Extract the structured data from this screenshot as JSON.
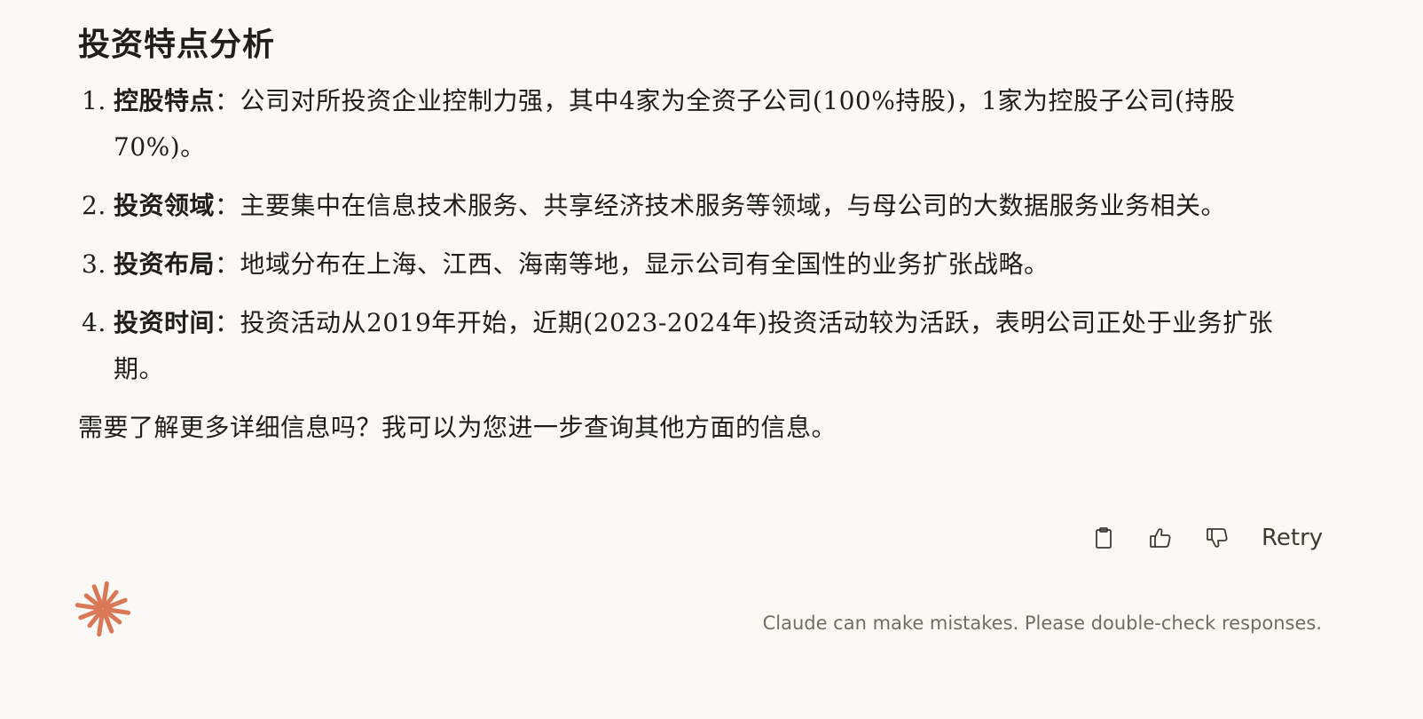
{
  "response": {
    "heading": "投资特点分析",
    "points": [
      {
        "num": "1.",
        "title": "控股特点",
        "sep": "：",
        "text": "公司对所投资企业控制力强，其中4家为全资子公司(100%持股)，1家为控股子公司(持股70%)。"
      },
      {
        "num": "2.",
        "title": "投资领域",
        "sep": "：",
        "text": "主要集中在信息技术服务、共享经济技术服务等领域，与母公司的大数据服务业务相关。"
      },
      {
        "num": "3.",
        "title": "投资布局",
        "sep": "：",
        "text": "地域分布在上海、江西、海南等地，显示公司有全国性的业务扩张战略。"
      },
      {
        "num": "4.",
        "title": "投资时间",
        "sep": "：",
        "text": "投资活动从2019年开始，近期(2023-2024年)投资活动较为活跃，表明公司正处于业务扩张期。"
      }
    ],
    "closing": "需要了解更多详细信息吗？我可以为您进一步查询其他方面的信息。"
  },
  "actions": {
    "copy_icon": "clipboard-icon",
    "like_icon": "thumbs-up-icon",
    "dislike_icon": "thumbs-down-icon",
    "retry_label": "Retry"
  },
  "footer": {
    "logo_icon": "claude-starburst-icon",
    "disclaimer": "Claude can make mistakes. Please double-check responses."
  },
  "colors": {
    "background": "#faf9f5",
    "text": "#1f1e1b",
    "muted": "#6f6d66",
    "brand": "#d97757"
  }
}
